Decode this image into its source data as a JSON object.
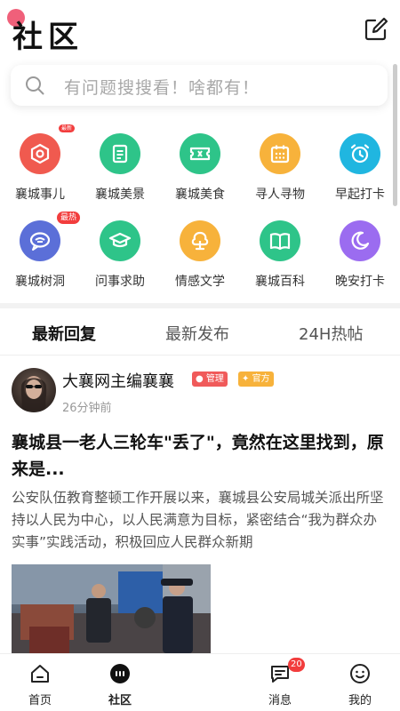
{
  "header": {
    "title": "社区"
  },
  "search": {
    "placeholder": "有问题搜搜看！啥都有！"
  },
  "categories": [
    {
      "label": "襄城事儿",
      "icon": "target-icon",
      "color": "#f05a4f",
      "badge": "最新"
    },
    {
      "label": "襄城美景",
      "icon": "document-icon",
      "color": "#2ec489"
    },
    {
      "label": "襄城美食",
      "icon": "ticket-icon",
      "color": "#2ec489"
    },
    {
      "label": "寻人寻物",
      "icon": "calendar-icon",
      "color": "#f7b23b"
    },
    {
      "label": "早起打卡",
      "icon": "alarm-clock-icon",
      "color": "#20b6e0"
    },
    {
      "label": "襄城树洞",
      "icon": "chat-bubble-icon",
      "color": "#5b6fd8",
      "badge": "最热"
    },
    {
      "label": "问事求助",
      "icon": "graduation-cap-icon",
      "color": "#2ec489"
    },
    {
      "label": "情感文学",
      "icon": "tree-icon",
      "color": "#f7b23b"
    },
    {
      "label": "襄城百科",
      "icon": "book-icon",
      "color": "#2ec489"
    },
    {
      "label": "晚安打卡",
      "icon": "moon-icon",
      "color": "#9b6cf0"
    }
  ],
  "tabs": [
    {
      "label": "最新回复",
      "active": true
    },
    {
      "label": "最新发布",
      "active": false
    },
    {
      "label": "24H热帖",
      "active": false
    }
  ],
  "post": {
    "author": "大襄网主编襄襄",
    "tag_admin": "管理",
    "tag_official": "官方",
    "time": "26分钟前",
    "title": "襄城县一老人三轮车\"丢了\"，竟然在这里找到，原来是...",
    "body": "公安队伍教育整顿工作开展以来，襄城县公安局城关派出所坚持以人民为中心，以人民满意为目标，紧密结合“我为群众办实事”实践活动，积极回应人民群众新期"
  },
  "tabbar": [
    {
      "label": "首页",
      "icon": "home-icon"
    },
    {
      "label": "社区",
      "icon": "community-icon"
    },
    {
      "label": "",
      "icon": "plus-icon"
    },
    {
      "label": "消息",
      "icon": "message-icon",
      "badge": "20"
    },
    {
      "label": "我的",
      "icon": "smile-icon"
    }
  ],
  "colors": {
    "accent": "#111111",
    "badge_red": "#f23d3d",
    "official_yellow": "#f7b23b"
  }
}
